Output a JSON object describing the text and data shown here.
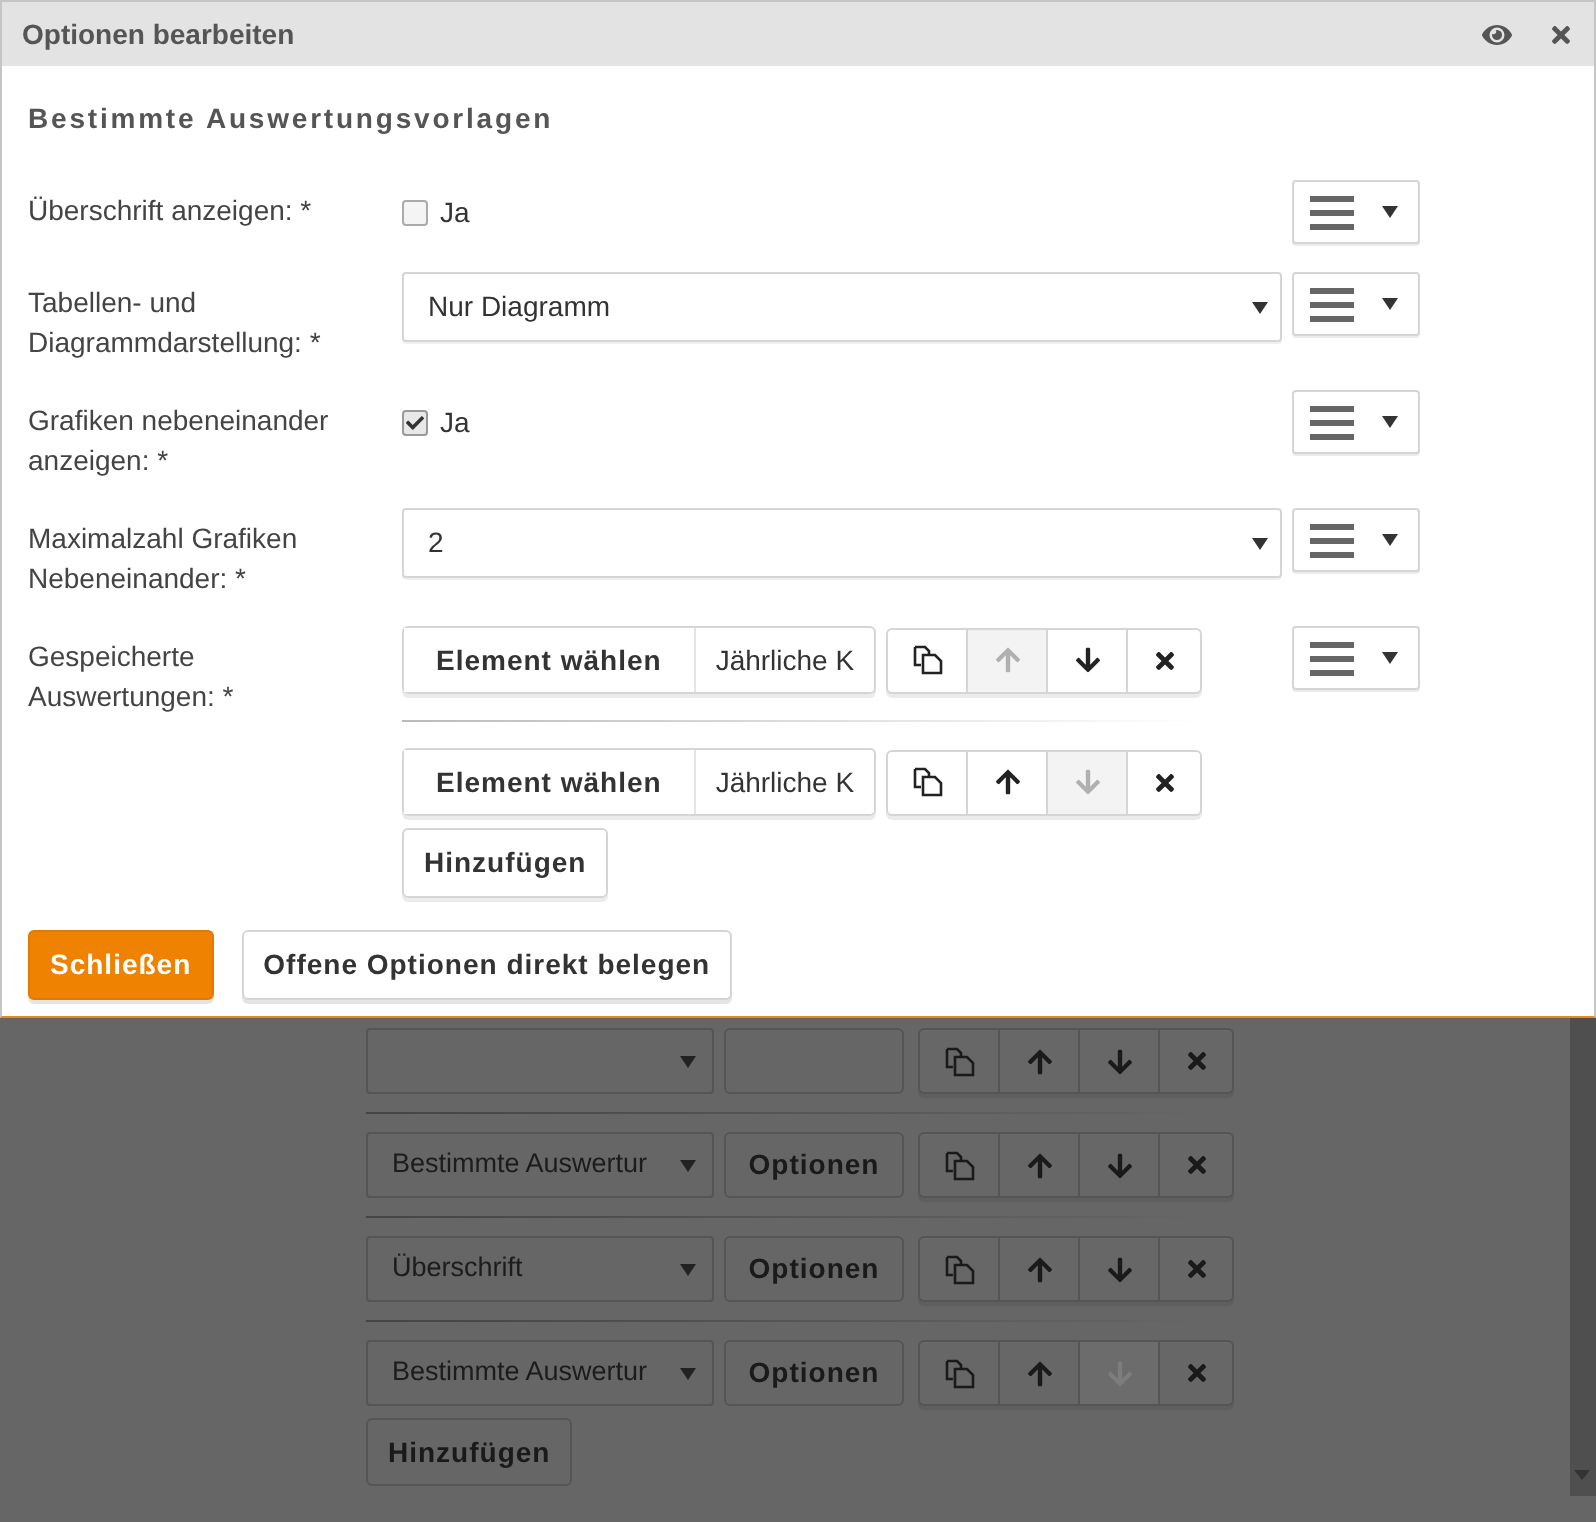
{
  "dialog": {
    "title": "Optionen bearbeiten",
    "heading": "Bestimmte Auswertungsvorlagen",
    "fields": [
      {
        "kind": "checkbox",
        "label": "Überschrift anzeigen: *",
        "checked": false,
        "option": "Ja"
      },
      {
        "kind": "select",
        "label": "Tabellen- und Diagrammdarstellung: *",
        "value": "Nur Diagramm"
      },
      {
        "kind": "checkbox",
        "label": "Grafiken nebeneinander anzeigen: *",
        "checked": true,
        "option": "Ja"
      },
      {
        "kind": "select",
        "label": "Maximalzahl Grafiken Nebeneinander: *",
        "value": "2"
      },
      {
        "kind": "list",
        "label": "Gespeicherte Auswertungen: *",
        "add_button": "Hinzufügen",
        "items": [
          {
            "button": "Element wählen",
            "value": "Jährliche K",
            "up_disabled": true,
            "down_disabled": false
          },
          {
            "button": "Element wählen",
            "value": "Jährliche K",
            "up_disabled": false,
            "down_disabled": true
          }
        ]
      }
    ],
    "buttons": [
      {
        "label": "Schließen",
        "primary": true
      },
      {
        "label": "Offene Optionen direkt belegen",
        "primary": false
      }
    ]
  },
  "background": {
    "add_button": "Hinzufügen",
    "rows": [
      {
        "up_disabled": false,
        "down_disabled": false
      },
      {
        "value": "Bestimmte Auswertur",
        "button": "Optionen",
        "up_disabled": false,
        "down_disabled": false
      },
      {
        "value": "Überschrift",
        "button": "Optionen",
        "up_disabled": false,
        "down_disabled": false
      },
      {
        "value": "Bestimmte Auswertur",
        "button": "Optionen",
        "up_disabled": false,
        "down_disabled": true
      }
    ]
  }
}
